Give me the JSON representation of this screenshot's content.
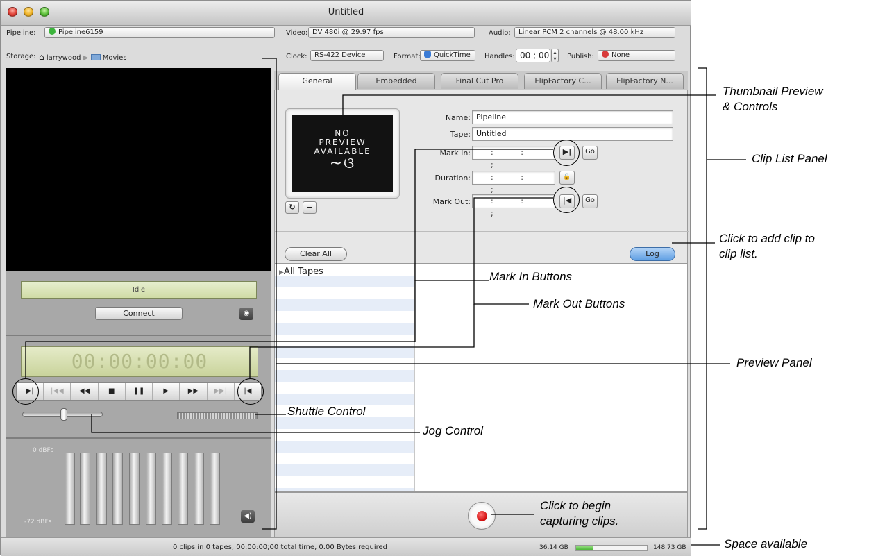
{
  "window": {
    "title": "Untitled"
  },
  "header": {
    "pipeline_label": "Pipeline:",
    "pipeline_value": "Pipeline6159",
    "video_label": "Video:",
    "video_value": "DV 480i @ 29.97 fps",
    "audio_label": "Audio:",
    "audio_value": "Linear PCM 2 channels @ 48.00 kHz",
    "storage_label": "Storage:",
    "storage_user": "larrywood",
    "storage_folder": "Movies",
    "clock_label": "Clock:",
    "clock_value": "RS-422 Device",
    "format_label": "Format:",
    "format_value": "QuickTime",
    "handles_label": "Handles:",
    "handles_value": "00 ; 00",
    "publish_label": "Publish:",
    "publish_value": "None"
  },
  "preview": {
    "status": "Idle",
    "connect_label": "Connect",
    "timecode": "00:00:00:00",
    "transport": [
      "▶|",
      "|◀◀",
      "◀◀",
      "■",
      "❚❚",
      "▶",
      "▶▶",
      "▶▶|",
      "|◀"
    ],
    "meter_top_label": "0 dBFs",
    "meter_bottom_label": "-72 dBFs"
  },
  "tabs": [
    "General",
    "Embedded",
    "Final Cut Pro",
    "FlipFactory C...",
    "FlipFactory N..."
  ],
  "general": {
    "thumb_text_1": "NO",
    "thumb_text_2": "PREVIEW",
    "thumb_text_3": "AVAILABLE",
    "name_label": "Name:",
    "name_value": "Pipeline",
    "tape_label": "Tape:",
    "tape_value": "Untitled",
    "markin_label": "Mark In:",
    "duration_label": "Duration:",
    "markout_label": "Mark Out:",
    "timecode_blank": ": : ;",
    "go_label": "Go",
    "clear_all_label": "Clear All",
    "log_label": "Log"
  },
  "clip_list": {
    "root_label": "All Tapes"
  },
  "statusbar": {
    "summary": "0 clips in 0 tapes, 00:00:00;00 total time, 0.00 Bytes required",
    "disk_used": "36.14 GB",
    "disk_total": "148.73 GB",
    "disk_fill_fraction": 0.24
  },
  "callouts": {
    "thumbnail": "Thumbnail Preview\n& Controls",
    "clip_list": "Clip List Panel",
    "add_clip": "Click to add clip to\nclip list.",
    "mark_in": "Mark In Buttons",
    "mark_out": "Mark Out Buttons",
    "preview_panel": "Preview Panel",
    "shuttle": "Shuttle Control",
    "jog": "Jog Control",
    "capture": "Click to begin\ncapturing clips.",
    "space": "Space available"
  },
  "colors": {
    "record": "#d10f0f",
    "log_button": "#5f9fe3",
    "disk_fill": "#3fae2b"
  }
}
